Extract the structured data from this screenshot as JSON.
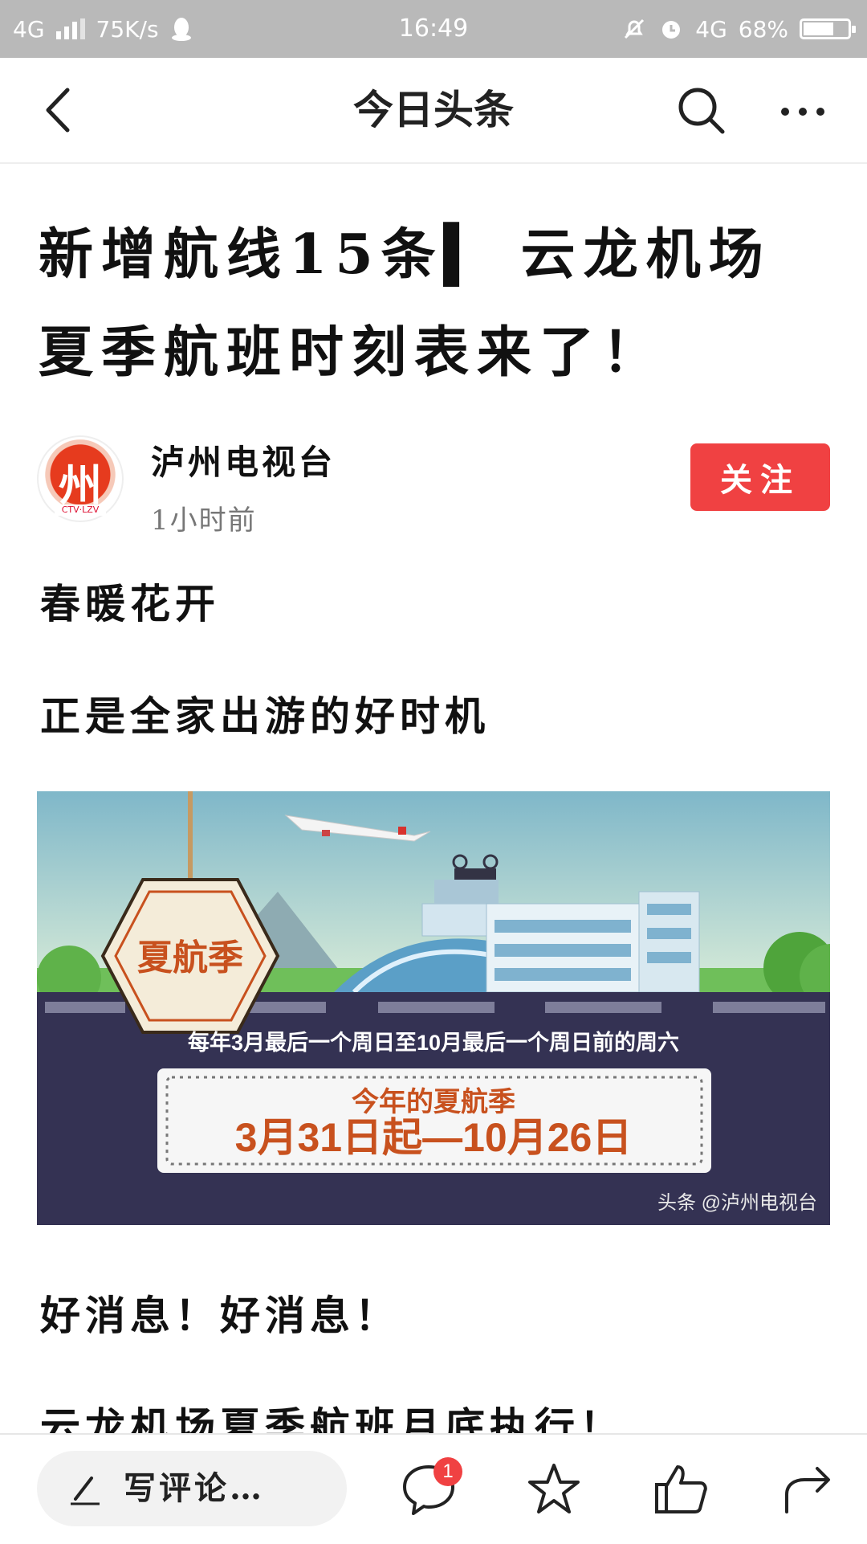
{
  "status_bar": {
    "network": "4G",
    "speed": "75K/s",
    "time": "16:49",
    "network_right": "4G",
    "battery": "68%",
    "battery_level": 0.68
  },
  "nav": {
    "title": "今日头条"
  },
  "article": {
    "title_line1": "新增航线15条▍ 云龙机场",
    "title_line2": "夏季航班时刻表来了！",
    "author": "泸州电视台",
    "avatar_mark": "州",
    "avatar_tag": "CTV·LZV",
    "time_ago": "1小时前",
    "follow_label": "关注",
    "paragraphs": [
      "春暖花开",
      "正是全家出游的好时机",
      "好消息！好消息！",
      "云龙机场夏季航班月底执行！"
    ]
  },
  "banner": {
    "badge": "夏航季",
    "rule_text": "每年3月最后一个周日至10月最后一个周日前的周六",
    "box_title": "今年的夏航季",
    "box_dates": "3月31日起—10月26日",
    "watermark": "头条 @泸州电视台"
  },
  "bottom_bar": {
    "comment_placeholder": "写评论…",
    "comment_count": "1"
  },
  "colors": {
    "accent": "#f04142",
    "status_bar": "#b9b9b9",
    "banner_road": "#343253",
    "banner_orange": "#c8511e"
  }
}
